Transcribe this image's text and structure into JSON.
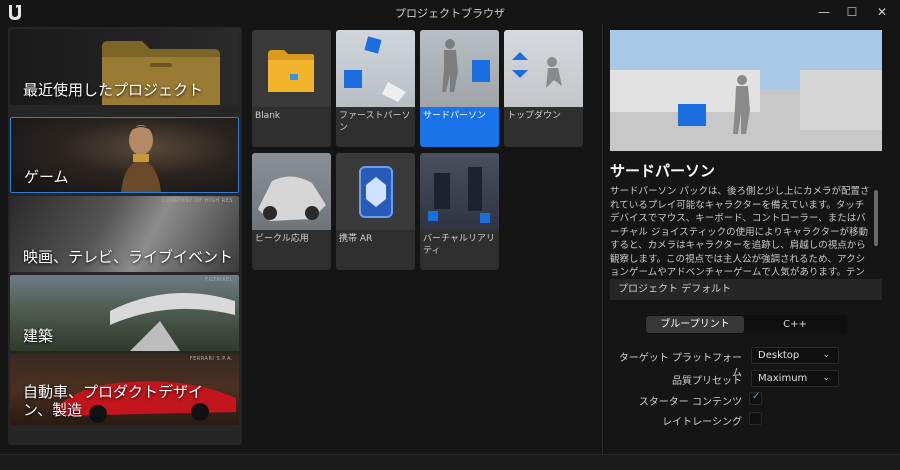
{
  "window": {
    "title": "プロジェクトブラウザ",
    "logo_icon": "unreal-engine-logo",
    "minimize_glyph": "—",
    "maximize_glyph": "☐",
    "close_glyph": "✕"
  },
  "categories": [
    {
      "label": "最近使用したプロジェクト",
      "icon": "folder-icon",
      "selected": false
    },
    {
      "label": "ゲーム",
      "selected": true
    },
    {
      "label": "映画、テレビ、ライブイベント",
      "watermark": "COURTESY OF HIGH RES",
      "selected": false
    },
    {
      "label": "建築",
      "watermark": "FILTPIXEL",
      "selected": false
    },
    {
      "label": "自動車、プロダクトデザイン、製造",
      "watermark": "FERRARI S.P.A.",
      "selected": false
    }
  ],
  "templates": [
    {
      "label": "Blank",
      "selected": false
    },
    {
      "label": "ファーストパーソン",
      "selected": false
    },
    {
      "label": "サードパーソン",
      "selected": true
    },
    {
      "label": "トップダウン",
      "selected": false
    },
    {
      "label": "ビークル応用",
      "selected": false
    },
    {
      "label": "携帯 AR",
      "selected": false
    },
    {
      "label": "バーチャルリアリティ",
      "selected": false
    }
  ],
  "detail": {
    "title": "サードパーソン",
    "description": "サードパーソン パックは、後ろ側と少し上にカメラが配置されているプレイ可能なキャラクターを備えています。タッチデバイスでマウス、キーボード、コントローラー、またはバーチャル ジョイスティックの使用によりキャラクターが移動すると、カメラはキャラクターを追跡し、肩越しの視点から観察します。この視点では主人公が強調されるため、アクションゲームやアドベンチャーゲームで人気があります。テンプレート マップには、プレイヤーがジャンプしたり押すことができるオブジェクトがいくつか含",
    "section_header": "プロジェクト デフォルト",
    "language_options": [
      "ブループリント",
      "C++"
    ],
    "language_selected": "ブループリント",
    "target_platform_label": "ターゲット プラットフォーム",
    "target_platform_value": "Desktop",
    "quality_preset_label": "品質プリセット",
    "quality_preset_value": "Maximum",
    "starter_content_label": "スターター コンテンツ",
    "starter_content_checked": true,
    "raytracing_label": "レイトレーシング",
    "raytracing_checked": false
  },
  "colors": {
    "accent": "#1a73e8",
    "selection_border": "#2f7bd6",
    "checkmark": "#4aa3ff",
    "background": "#151515",
    "panel": "#262626"
  }
}
